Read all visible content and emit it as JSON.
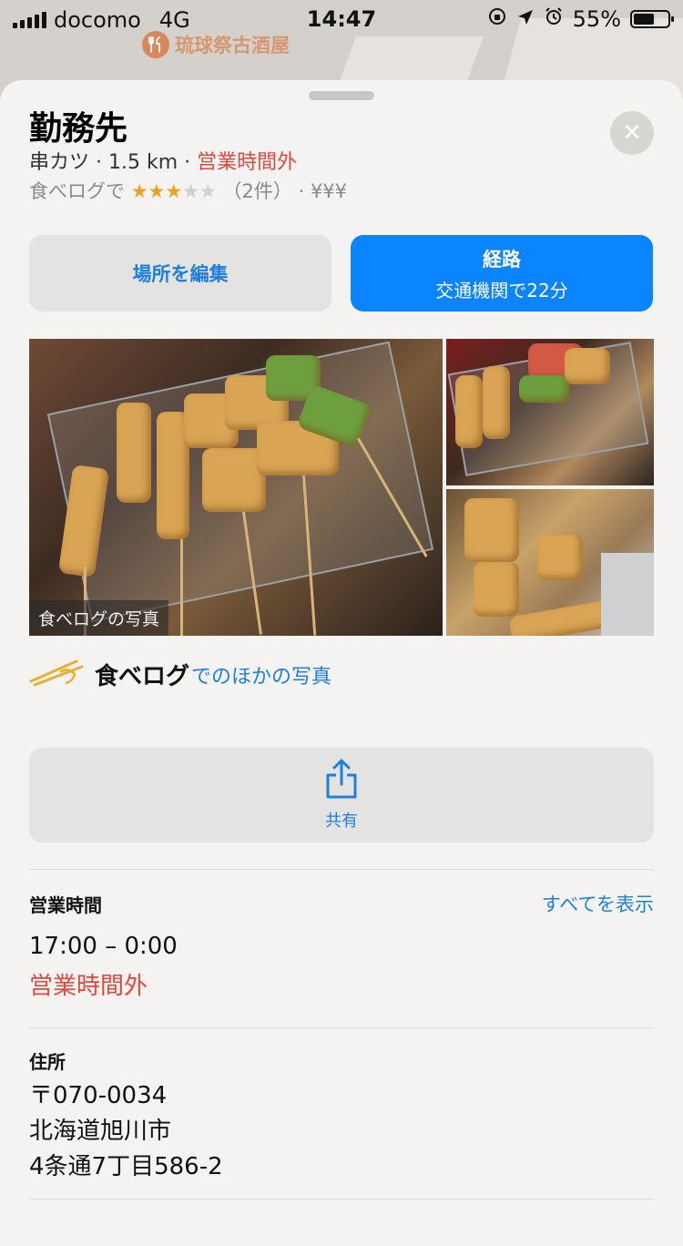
{
  "status_bar": {
    "carrier": "docomo",
    "network": "4G",
    "time": "14:47",
    "battery": "55%",
    "battery_level": 0.55
  },
  "map": {
    "poi_label": "琉球祭古酒屋",
    "poi_icon": "fork-knife-icon"
  },
  "place": {
    "name": "勤務先",
    "category": "串カツ",
    "distance": "1.5 km",
    "open_status": "営業時間外",
    "rating_source": "食べログで",
    "rating_stars": 3,
    "rating_max": 5,
    "review_count": "（2件）",
    "price": "¥¥¥"
  },
  "actions": {
    "edit_label": "場所を編集",
    "route_label": "経路",
    "route_detail": "交通機関で22分",
    "share_label": "共有",
    "share_icon": "share-icon",
    "close_icon": "close-icon"
  },
  "photos": {
    "badge": "食べログの写真",
    "brand": "食べログ",
    "more_link": "でのほかの写真"
  },
  "hours": {
    "title": "営業時間",
    "show_all": "すべてを表示",
    "range": "17:00 – 0:00",
    "status": "営業時間外"
  },
  "address": {
    "title": "住所",
    "postal": "〒070-0034",
    "city": "北海道旭川市",
    "street": "4条通7丁目586-2"
  },
  "colors": {
    "accent": "#0a84ff",
    "link": "#1f7fe0",
    "closed_red": "#e0483e",
    "star": "#f0a020"
  }
}
